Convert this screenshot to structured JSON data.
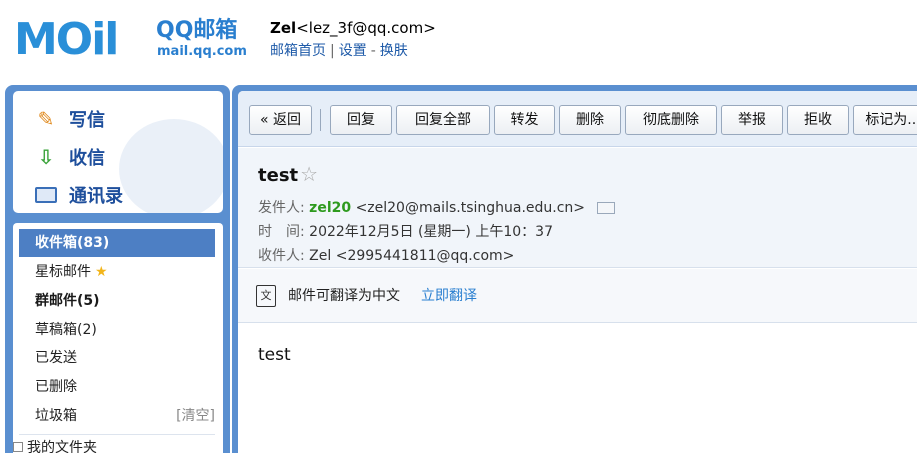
{
  "header": {
    "logo_brand": "MOil",
    "logo_product": "QQ邮箱",
    "logo_domain": "mail.qq.com",
    "user_name": "Zel",
    "user_email": "<lez_3f@qq.com>",
    "links": {
      "home": "邮箱首页",
      "sep1": "|",
      "settings": "设置",
      "sep2": "-",
      "skin": "换肤"
    }
  },
  "sidebar": {
    "actions": {
      "compose": "写信",
      "inbox": "收信",
      "contacts": "通讯录"
    },
    "folders": [
      {
        "label": "收件箱(83)"
      },
      {
        "label": "星标邮件"
      },
      {
        "label": "群邮件(5)"
      },
      {
        "label": "草稿箱(2)"
      },
      {
        "label": "已发送"
      },
      {
        "label": "已删除"
      },
      {
        "label": "垃圾箱"
      }
    ],
    "clear_label": "[清空]",
    "my_folders": "我的文件夹"
  },
  "toolbar": {
    "back": "« 返回",
    "reply": "回复",
    "reply_all": "回复全部",
    "forward": "转发",
    "delete": "删除",
    "delete_forever": "彻底删除",
    "report": "举报",
    "reject": "拒收",
    "mark_as": "标记为..."
  },
  "message": {
    "subject": "test",
    "from_label": "发件人:",
    "from_name": "zel20",
    "from_email": "<zel20@mails.tsinghua.edu.cn>",
    "time_label": "时　间:",
    "time_value": "2022年12月5日 (星期一) 上午10：37",
    "to_label": "收件人:",
    "to_value": "Zel <2995441811@qq.com>",
    "translate_text": "邮件可翻译为中文",
    "translate_link": "立即翻译",
    "body": "test"
  },
  "colors": {
    "accent_blue": "#5a8fd0",
    "active_folder": "#4d7fc4",
    "sender_green": "#2e9a1e",
    "link_blue": "#2a7fd0"
  }
}
